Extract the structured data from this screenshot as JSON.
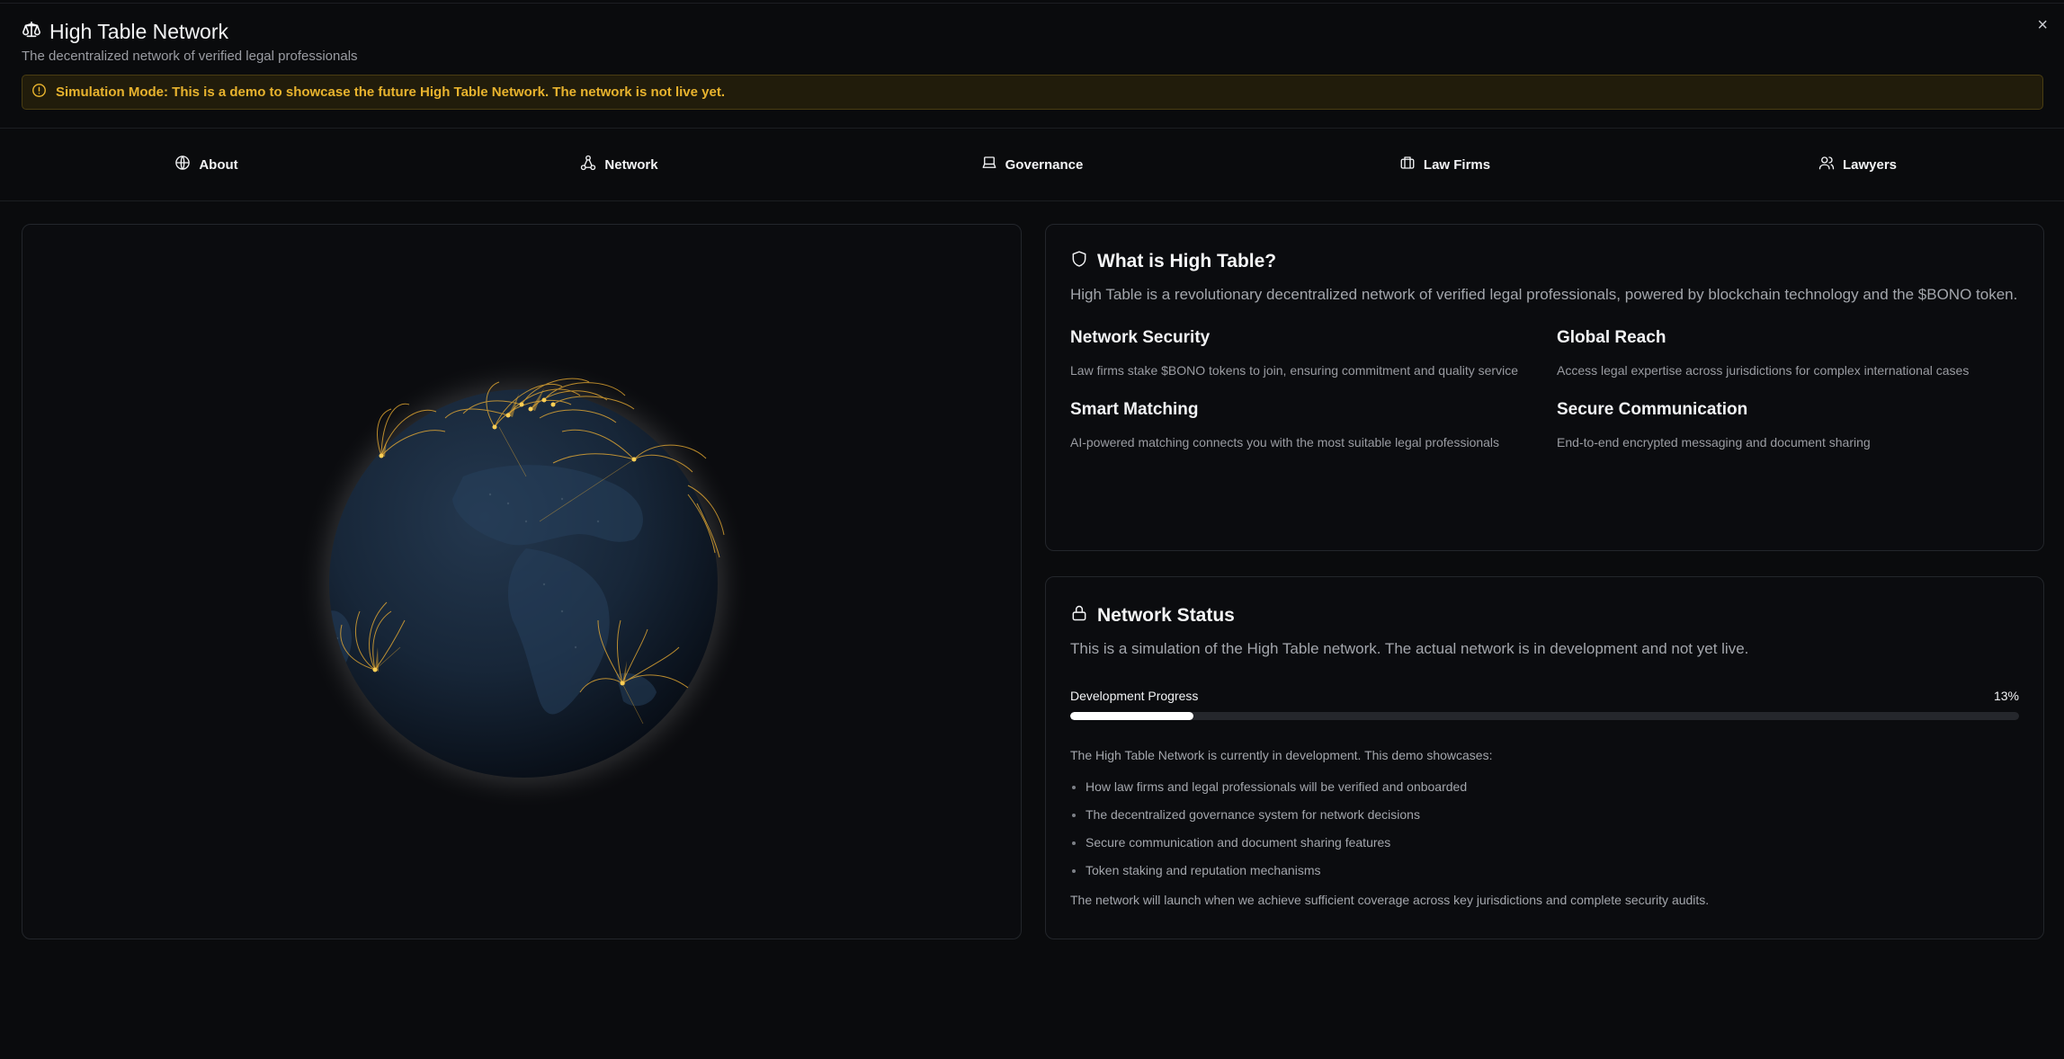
{
  "app": {
    "title": "High Table Network",
    "subtitle": "The decentralized network of verified legal professionals",
    "close_label": "×"
  },
  "banner": {
    "text": "Simulation Mode: This is a demo to showcase the future High Table Network. The network is not live yet.",
    "color": "#e8b32e"
  },
  "tabs": [
    {
      "label": "About",
      "icon": "globe-icon"
    },
    {
      "label": "Network",
      "icon": "network-icon"
    },
    {
      "label": "Governance",
      "icon": "laptop-icon"
    },
    {
      "label": "Law Firms",
      "icon": "briefcase-icon"
    },
    {
      "label": "Lawyers",
      "icon": "users-icon"
    }
  ],
  "about": {
    "title": "What is High Table?",
    "description": "High Table is a revolutionary decentralized network of verified legal professionals, powered by blockchain technology and the $BONO token.",
    "features": [
      {
        "title": "Network Security",
        "desc": "Law firms stake $BONO tokens to join, ensuring commitment and quality service"
      },
      {
        "title": "Global Reach",
        "desc": "Access legal expertise across jurisdictions for complex international cases"
      },
      {
        "title": "Smart Matching",
        "desc": "AI-powered matching connects you with the most suitable legal professionals"
      },
      {
        "title": "Secure Communication",
        "desc": "End-to-end encrypted messaging and document sharing"
      }
    ]
  },
  "status": {
    "title": "Network Status",
    "description": "This is a simulation of the High Table network. The actual network is in development and not yet live.",
    "progress_label": "Development Progress",
    "progress_value": "13%",
    "progress_fraction": 0.13,
    "intro": "The High Table Network is currently in development. This demo showcases:",
    "items": [
      "How law firms and legal professionals will be verified and onboarded",
      "The decentralized governance system for network decisions",
      "Secure communication and document sharing features",
      "Token staking and reputation mechanisms"
    ],
    "footer": "The network will launch when we achieve sufficient coverage across key jurisdictions and complete security audits."
  },
  "colors": {
    "background": "#0a0b0d",
    "accent": "#e8b32e",
    "arc": "#f2b233"
  }
}
